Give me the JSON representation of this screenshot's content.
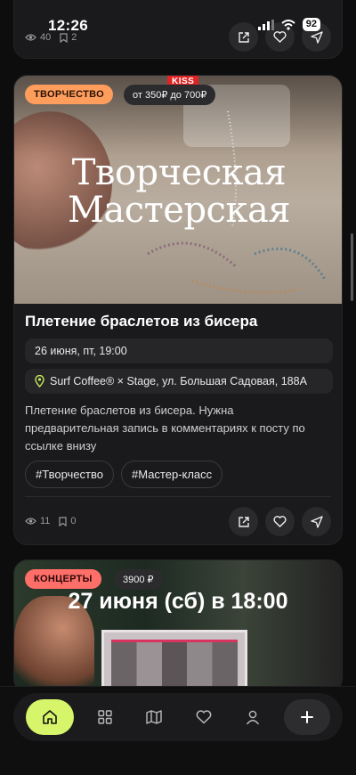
{
  "status": {
    "time": "12:26",
    "battery": "92"
  },
  "prev_card": {
    "views": "40",
    "saves": "2"
  },
  "event": {
    "category": "ТВОРЧЕСТВО",
    "price": "от 350₽ до 700₽",
    "hero_brand": "KISS",
    "hero_title_line1": "Творческая",
    "hero_title_line2": "Мастерская",
    "title": "Плетение браслетов из бисера",
    "date": "26 июня, пт, 19:00",
    "location": "Surf Coffee® × Stage, ул. Большая Садовая, 188А",
    "description": "Плетение браслетов из бисера. Нужна предварительная запись в комментариях к посту по ссылке внизу",
    "tags": [
      "#Творчество",
      "#Мастер-класс"
    ],
    "views": "11",
    "saves": "0"
  },
  "next_event": {
    "category": "КОНЦЕРТЫ",
    "price": "3900 ₽",
    "hero_title": "27 июня (сб) в 18:00"
  },
  "colors": {
    "accent": "#d7f56a",
    "badge_creative": "#ff9d5c",
    "badge_concert": "#ff6f6a",
    "location_pin": "#c7e85a"
  },
  "nav": [
    "home-icon",
    "grid-icon",
    "map-icon",
    "heart-icon",
    "profile-icon",
    "plus-icon"
  ]
}
